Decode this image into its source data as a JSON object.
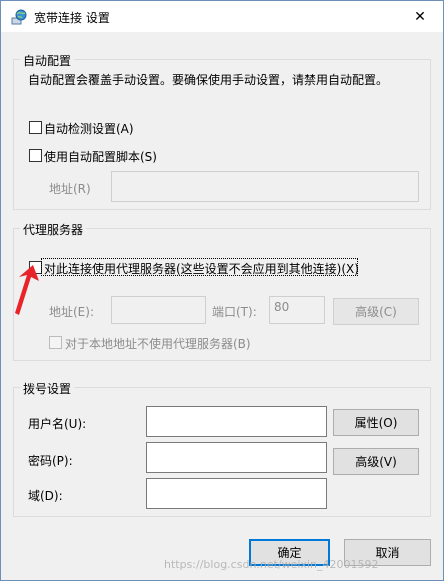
{
  "window": {
    "title": "宽带连接 设置",
    "close_glyph": "✕"
  },
  "auto_config": {
    "group_label": "自动配置",
    "description": "自动配置会覆盖手动设置。要确保使用手动设置，请禁用自动配置。",
    "auto_detect_label": "自动检测设置(A)",
    "auto_detect_checked": false,
    "use_script_label": "使用自动配置脚本(S)",
    "use_script_checked": false,
    "address_label": "地址(R)",
    "address_value": ""
  },
  "proxy": {
    "group_label": "代理服务器",
    "use_proxy_label": "对此连接使用代理服务器(这些设置不会应用到其他连接)(X)",
    "use_proxy_checked": false,
    "address_label": "地址(E):",
    "address_value": "",
    "port_label": "端口(T):",
    "port_value": "80",
    "advanced_label": "高级(C)",
    "bypass_local_label": "对于本地地址不使用代理服务器(B)",
    "bypass_local_checked": false
  },
  "dialup": {
    "group_label": "拨号设置",
    "username_label": "用户名(U):",
    "username_value": "",
    "properties_label": "属性(O)",
    "password_label": "密码(P):",
    "password_value": "",
    "advanced_label": "高级(V)",
    "domain_label": "域(D):",
    "domain_value": ""
  },
  "footer": {
    "ok_label": "确定",
    "cancel_label": "取消"
  },
  "watermark": "https://blog.csdn.net/weixin_42001592",
  "colors": {
    "accent": "#0078d7",
    "annotation_arrow": "#e8242a"
  },
  "icons": {
    "title": "network-globe-icon",
    "annotation": "red-arrow-icon"
  }
}
